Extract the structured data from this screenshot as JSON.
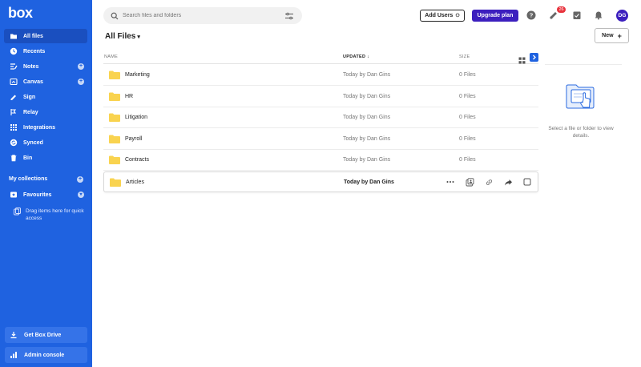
{
  "app": {
    "logo_text": "box"
  },
  "sidebar": {
    "items": [
      {
        "label": "All files",
        "icon": "folder-icon"
      },
      {
        "label": "Recents",
        "icon": "clock-icon"
      },
      {
        "label": "Notes",
        "icon": "notes-icon"
      },
      {
        "label": "Canvas",
        "icon": "canvas-icon"
      },
      {
        "label": "Sign",
        "icon": "sign-icon"
      },
      {
        "label": "Relay",
        "icon": "relay-icon"
      },
      {
        "label": "Integrations",
        "icon": "grid-icon"
      },
      {
        "label": "Synced",
        "icon": "sync-icon"
      },
      {
        "label": "Bin",
        "icon": "trash-icon"
      }
    ],
    "collections_label": "My collections",
    "favourites_label": "Favourites",
    "drag_hint": "Drag items here for quick access",
    "get_drive_label": "Get Box Drive",
    "admin_console_label": "Admin console"
  },
  "search": {
    "placeholder": "Search files and folders"
  },
  "header": {
    "add_users_label": "Add Users",
    "upgrade_label": "Upgrade plan",
    "notification_count": "26",
    "avatar_initials": "DG"
  },
  "main": {
    "title": "All Files",
    "new_label": "New",
    "columns": {
      "name": "NAME",
      "updated": "UPDATED",
      "size": "SIZE"
    },
    "rows": [
      {
        "name": "Marketing",
        "updated": "Today by Dan Gins",
        "size": "0 Files"
      },
      {
        "name": "HR",
        "updated": "Today by Dan Gins",
        "size": "0 Files"
      },
      {
        "name": "Litigation",
        "updated": "Today by Dan Gins",
        "size": "0 Files"
      },
      {
        "name": "Payroll",
        "updated": "Today by Dan Gins",
        "size": "0 Files"
      },
      {
        "name": "Contracts",
        "updated": "Today by Dan Gins",
        "size": "0 Files"
      },
      {
        "name": "Articles",
        "updated": "Today by Dan Gins",
        "size": ""
      }
    ]
  },
  "details": {
    "empty_text": "Select a file or folder to view details."
  },
  "colors": {
    "sidebar": "#1f62e0",
    "accent": "#3c1fbe",
    "folder": "#f9d34f"
  }
}
